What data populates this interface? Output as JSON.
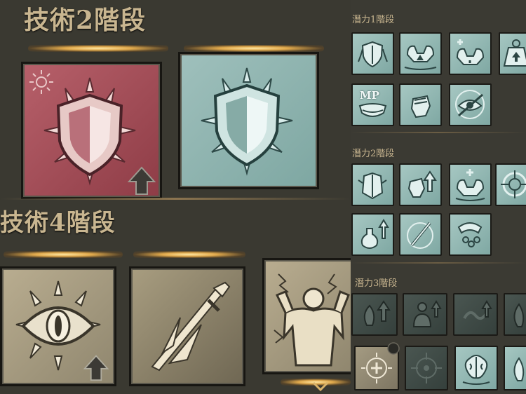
{
  "left": {
    "section_a_title": "技術2階段",
    "section_b_title": "技術4階段"
  },
  "right": {
    "potential_1_title": "潛力1階段",
    "potential_2_title": "潛力2階段",
    "potential_3_title": "潛力3階段",
    "mp_label": "MP"
  },
  "colors": {
    "title": "#c9b690",
    "red_tile": "#b7606a",
    "teal_tile": "#9fc0bc",
    "sand_tile": "#b9ad90",
    "glow": "#e0a94c"
  },
  "icons": {
    "section_a": [
      "shield-spike-icon",
      "shield-spike-icon"
    ],
    "section_b": [
      "eye-icon",
      "swift-blade-icon",
      "muscle-figure-icon"
    ],
    "potential_1": [
      "leaf-shield-icon",
      "flex-arms-icon",
      "flex-arms-plus-icon",
      "weight-up-icon",
      "mp-mouth-icon",
      "fist-icon",
      "eye-slash-icon"
    ],
    "potential_2": [
      "armor-plus-icon",
      "fist-up-icon",
      "flex-arms-sparkle-icon",
      "target-icon",
      "potion-icon",
      "sword-ring-icon",
      "chain-hand-icon"
    ],
    "potential_3": [
      "leaf-up-icon",
      "figure-up-icon",
      "chain-dark-icon",
      "leaf-dark-icon",
      "crosshair-plus-icon",
      "target-dark-icon",
      "brain-icon",
      "leaf-teal-icon"
    ]
  }
}
